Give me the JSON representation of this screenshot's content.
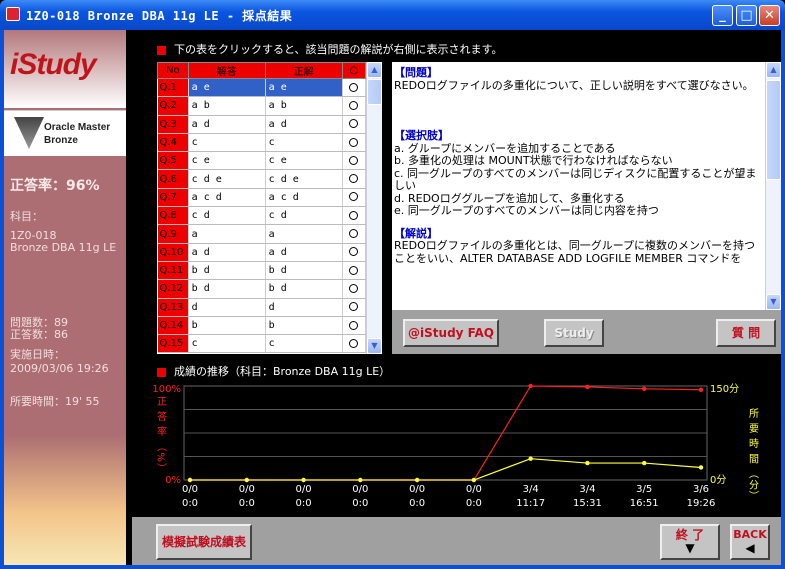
{
  "window": {
    "title": "1Z0-018 Bronze DBA 11g LE - 採点結果"
  },
  "sidebar": {
    "logo": "iStudy",
    "oracle_line1": "Oracle Master",
    "oracle_line2": "Bronze",
    "rate_label": "正答率：96%",
    "subject_label": "科目：",
    "subject_line1": "1Z0-018",
    "subject_line2": "Bronze DBA 11g LE",
    "questions": "問題数：89",
    "correct": "正答数：86",
    "date_label": "実施日時：",
    "date_value": "2009/03/06 19:26",
    "time_required": "所要時間：19' 55"
  },
  "instruction": "下の表をクリックすると、該当問題の解説が右側に表示されます。",
  "table": {
    "headers": [
      "No",
      "解答",
      "正解",
      "○"
    ],
    "rows": [
      {
        "no": "Q.1",
        "answer": "a e",
        "correct": "a e"
      },
      {
        "no": "Q.2",
        "answer": "a b",
        "correct": "a b"
      },
      {
        "no": "Q.3",
        "answer": "a d",
        "correct": "a d"
      },
      {
        "no": "Q.4",
        "answer": "c",
        "correct": "c"
      },
      {
        "no": "Q.5",
        "answer": "c e",
        "correct": "c e"
      },
      {
        "no": "Q.6",
        "answer": "c d e",
        "correct": "c d e"
      },
      {
        "no": "Q.7",
        "answer": "a c d",
        "correct": "a c d"
      },
      {
        "no": "Q.8",
        "answer": "c d",
        "correct": "c d"
      },
      {
        "no": "Q.9",
        "answer": "a",
        "correct": "a"
      },
      {
        "no": "Q.10",
        "answer": "a d",
        "correct": "a d"
      },
      {
        "no": "Q.11",
        "answer": "b d",
        "correct": "b d"
      },
      {
        "no": "Q.12",
        "answer": "b d",
        "correct": "b d"
      },
      {
        "no": "Q.13",
        "answer": "d",
        "correct": "d"
      },
      {
        "no": "Q.14",
        "answer": "b",
        "correct": "b"
      },
      {
        "no": "Q.15",
        "answer": "c",
        "correct": "c"
      }
    ]
  },
  "explanation": {
    "q_header": "【問題】",
    "question": "REDOログファイルの多重化について、正しい説明をすべて選びなさい。",
    "choices_header": "【選択肢】",
    "choice_a": "a. グループにメンバーを追加することである",
    "choice_b": "b. 多重化の処理は MOUNT状態で行わなければならない",
    "choice_c": "c. 同一グループのすべてのメンバーは同じディスクに配置することが望ましい",
    "choice_d": "d. REDOロググループを追加して、多重化する",
    "choice_e": "e. 同一グループのすべてのメンバーは同じ内容を持つ",
    "expl_header": "【解説】",
    "expl_line1": "REDOログファイルの多重化とは、同一グループに複数のメンバーを持つ",
    "expl_line2": "ことをいい、ALTER DATABASE ADD LOGFILE MEMBER コマンドを"
  },
  "buttons": {
    "faq": "@iStudy FAQ",
    "study": "Study",
    "question": "質 問",
    "mock_results": "模擬試験成績表",
    "end": "終 了",
    "back": "BACK"
  },
  "chart_title": "成績の推移（科目：Bronze DBA 11g LE）",
  "chart_data": {
    "type": "line",
    "categories": [
      "0/0\n0:0",
      "0/0\n0:0",
      "0/0\n0:0",
      "0/0\n0:0",
      "0/0\n0:0",
      "0/0\n0:0",
      "3/4\n11:17",
      "3/4\n15:31",
      "3/5\n16:51",
      "3/6\n19:26"
    ],
    "x_top": [
      "0/0",
      "0/0",
      "0/0",
      "0/0",
      "0/0",
      "0/0",
      "3/4",
      "3/4",
      "3/5",
      "3/6"
    ],
    "x_bottom": [
      "0:0",
      "0:0",
      "0:0",
      "0:0",
      "0:0",
      "0:0",
      "11:17",
      "15:31",
      "16:51",
      "19:26"
    ],
    "series": [
      {
        "name": "正答率（%）",
        "color": "#ff2020",
        "axis": "left",
        "values": [
          0,
          0,
          0,
          0,
          0,
          0,
          100,
          99,
          97,
          96
        ]
      },
      {
        "name": "所要時間（分）",
        "color": "#ffff40",
        "axis": "right",
        "values": [
          0,
          0,
          0,
          0,
          0,
          0,
          34,
          27,
          27,
          20
        ]
      }
    ],
    "left_axis": {
      "label": "正 答 率 （%）",
      "min_label": "0%",
      "max_label": "100%",
      "ylim": [
        0,
        100
      ]
    },
    "right_axis": {
      "label": "所 要 時 間 （分）",
      "min_label": "0分",
      "max_label": "150分",
      "ylim": [
        0,
        150
      ]
    },
    "grid": true
  }
}
